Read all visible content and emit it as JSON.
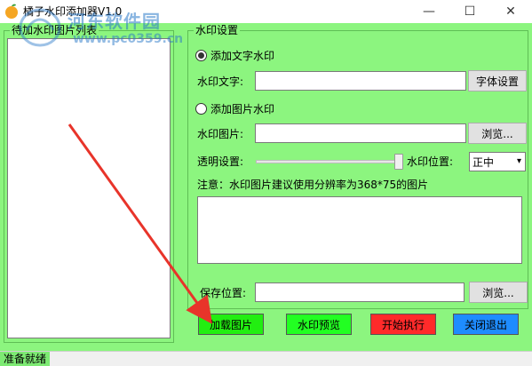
{
  "window": {
    "title": "橘子水印添加器V1.0",
    "controls": {
      "minimize": "—",
      "maximize": "☐",
      "close": "✕"
    }
  },
  "left_panel": {
    "title": "待加水印图片列表"
  },
  "watermark_settings": {
    "group_title": "水印设置",
    "text_mode_label": "添加文字水印",
    "text_mode_selected": true,
    "text_label": "水印文字:",
    "text_value": "",
    "font_button": "字体设置",
    "image_mode_label": "添加图片水印",
    "image_mode_selected": false,
    "image_label": "水印图片:",
    "image_value": "",
    "browse_button": "浏览...",
    "opacity_label": "透明设置:",
    "opacity_level": 1.0,
    "position_label": "水印位置:",
    "position_value": "正中",
    "note": "注意：水印图片建议使用分辨率为368*75的图片"
  },
  "save": {
    "label": "保存位置:",
    "value": "",
    "browse_button": "浏览..."
  },
  "actions": {
    "load": {
      "label": "加载图片",
      "color": "#22ee11"
    },
    "preview": {
      "label": "水印预览",
      "color": "#22ff22"
    },
    "start": {
      "label": "开始执行",
      "color": "#ff2a2a"
    },
    "exit": {
      "label": "关闭退出",
      "color": "#1e8cff"
    }
  },
  "status": {
    "text": "准备就绪"
  },
  "overlay": {
    "watermark_text": "河东软件园",
    "watermark_url": "www.pc0359.cn",
    "arrow_color": "#e8342a"
  }
}
